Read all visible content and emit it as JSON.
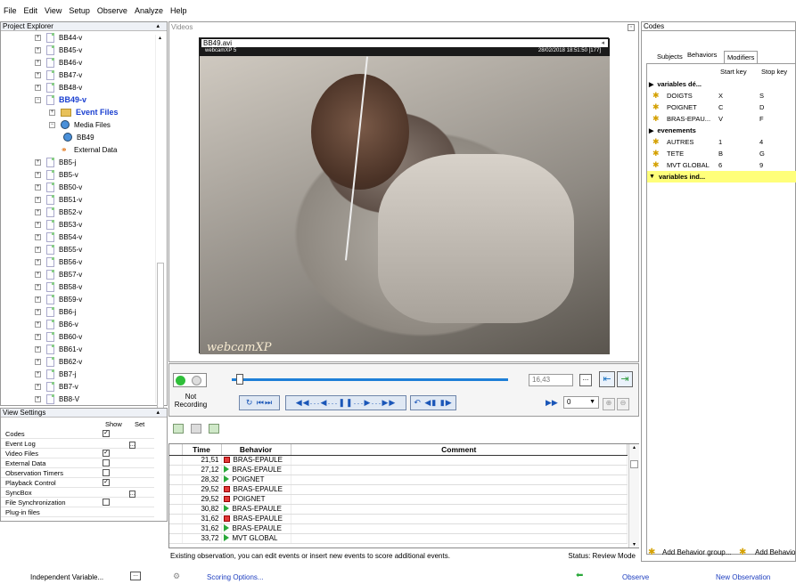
{
  "menu": [
    "File",
    "Edit",
    "View",
    "Setup",
    "Observe",
    "Analyze",
    "Help"
  ],
  "project_explorer": {
    "title": "Project Explorer",
    "items": [
      {
        "label": "BB44-v",
        "type": "doc",
        "level": 1,
        "expanded": false
      },
      {
        "label": "BB45-v",
        "type": "doc",
        "level": 1,
        "expanded": false
      },
      {
        "label": "BB46-v",
        "type": "doc",
        "level": 1,
        "expanded": false
      },
      {
        "label": "BB47-v",
        "type": "doc",
        "level": 1,
        "expanded": false
      },
      {
        "label": "BB48-v",
        "type": "doc",
        "level": 1,
        "expanded": false
      },
      {
        "label": "BB49-v",
        "type": "doc",
        "level": 1,
        "expanded": true,
        "active": true
      },
      {
        "label": "Event Files",
        "type": "folder",
        "level": 2,
        "expanded": false,
        "active": true
      },
      {
        "label": "Media Files",
        "type": "cam",
        "level": 2,
        "expanded": true
      },
      {
        "label": "BB49",
        "type": "cam",
        "level": 3
      },
      {
        "label": "External Data",
        "type": "ext",
        "level": 2
      },
      {
        "label": "BB5-j",
        "type": "doc",
        "level": 1
      },
      {
        "label": "BB5-v",
        "type": "doc",
        "level": 1
      },
      {
        "label": "BB50-v",
        "type": "doc",
        "level": 1
      },
      {
        "label": "BB51-v",
        "type": "doc",
        "level": 1
      },
      {
        "label": "BB52-v",
        "type": "doc",
        "level": 1
      },
      {
        "label": "BB53-v",
        "type": "doc",
        "level": 1
      },
      {
        "label": "BB54-v",
        "type": "doc",
        "level": 1
      },
      {
        "label": "BB55-v",
        "type": "doc",
        "level": 1
      },
      {
        "label": "BB56-v",
        "type": "doc",
        "level": 1
      },
      {
        "label": "BB57-v",
        "type": "doc",
        "level": 1
      },
      {
        "label": "BB58-v",
        "type": "doc",
        "level": 1
      },
      {
        "label": "BB59-v",
        "type": "doc",
        "level": 1
      },
      {
        "label": "BB6-j",
        "type": "doc",
        "level": 1
      },
      {
        "label": "BB6-v",
        "type": "doc",
        "level": 1
      },
      {
        "label": "BB60-v",
        "type": "doc",
        "level": 1
      },
      {
        "label": "BB61-v",
        "type": "doc",
        "level": 1
      },
      {
        "label": "BB62-v",
        "type": "doc",
        "level": 1
      },
      {
        "label": "BB7-j",
        "type": "doc",
        "level": 1
      },
      {
        "label": "BB7-v",
        "type": "doc",
        "level": 1
      },
      {
        "label": "BB8-V",
        "type": "doc",
        "level": 1
      }
    ]
  },
  "view_settings": {
    "title": "View Settings",
    "col_show": "Show",
    "col_set": "Set",
    "rows": [
      {
        "label": "Codes",
        "show": true,
        "set": false
      },
      {
        "label": "Event Log",
        "show": false,
        "set": true
      },
      {
        "label": "Video Files",
        "show": true,
        "set": false
      },
      {
        "label": "External Data",
        "show": false,
        "set": false
      },
      {
        "label": "Observation Timers",
        "show": false,
        "set": false
      },
      {
        "label": "Playback Control",
        "show": true,
        "set": false
      },
      {
        "label": "SyncBox",
        "show": false,
        "set": true
      },
      {
        "label": "File Synchronization",
        "show": false,
        "set": false
      },
      {
        "label": "Plug-in files",
        "show": false,
        "set": false
      }
    ]
  },
  "videos": {
    "title": "Videos",
    "file_name": "BB49.avi",
    "overlay_left": "webcamXP 5",
    "overlay_right": "28/02/2018 18:51:50  [177]",
    "watermark": "webcamXP"
  },
  "playback": {
    "recording_status": "Not Recording",
    "time_value": "16,43",
    "speed_value": "0",
    "slider_fraction": 0.03
  },
  "event_log": {
    "columns": [
      "Time",
      "Behavior",
      "Comment"
    ],
    "rows": [
      {
        "time": "21,51",
        "marker": "red",
        "behavior": "BRAS-EPAULE"
      },
      {
        "time": "27,12",
        "marker": "green",
        "behavior": "BRAS-EPAULE"
      },
      {
        "time": "28,32",
        "marker": "green",
        "behavior": "POIGNET"
      },
      {
        "time": "29,52",
        "marker": "red",
        "behavior": "BRAS-EPAULE"
      },
      {
        "time": "29,52",
        "marker": "red",
        "behavior": "POIGNET"
      },
      {
        "time": "30,82",
        "marker": "green",
        "behavior": "BRAS-EPAULE"
      },
      {
        "time": "31,62",
        "marker": "red",
        "behavior": "BRAS-EPAULE"
      },
      {
        "time": "31,62",
        "marker": "green",
        "behavior": "BRAS-EPAULE"
      },
      {
        "time": "33,72",
        "marker": "green",
        "behavior": "MVT GLOBAL"
      }
    ],
    "status_message": "Existing observation, you can edit events or insert new events to score additional events.",
    "status_mode": "Status: Review Mode"
  },
  "codes": {
    "title": "Codes",
    "tabs": [
      "Subjects",
      "Behaviors",
      "Modifiers"
    ],
    "active_tab": "Behaviors",
    "col_start": "Start key",
    "col_stop": "Stop key",
    "groups": [
      {
        "name": "variables dé...",
        "items": [
          {
            "name": "DOIGTS",
            "start": "X",
            "stop": "S"
          },
          {
            "name": "POIGNET",
            "start": "C",
            "stop": "D"
          },
          {
            "name": "BRAS-EPAU...",
            "start": "V",
            "stop": "F"
          }
        ]
      },
      {
        "name": "evenements",
        "items": [
          {
            "name": "AUTRES",
            "start": "1",
            "stop": "4"
          },
          {
            "name": "TETE",
            "start": "B",
            "stop": "G"
          },
          {
            "name": "MVT GLOBAL",
            "start": "6",
            "stop": "9"
          }
        ]
      },
      {
        "name": "variables ind...",
        "items": [],
        "highlighted": true
      }
    ],
    "add_group": "Add Behavior group...",
    "add_behavior": "Add Behavio"
  },
  "bottom_bar": {
    "independent_variable": "Independent Variable...",
    "scoring_options": "Scoring Options...",
    "observe": "Observe",
    "new_observation": "New Observation"
  },
  "colors": {
    "record_green": "#2fbf3a",
    "slider_blue": "#1e7fd7",
    "highlight_yellow": "#ffff7a",
    "red_marker": "#e23a3a",
    "green_marker": "#2aa83a",
    "link_blue": "#2040c0"
  }
}
